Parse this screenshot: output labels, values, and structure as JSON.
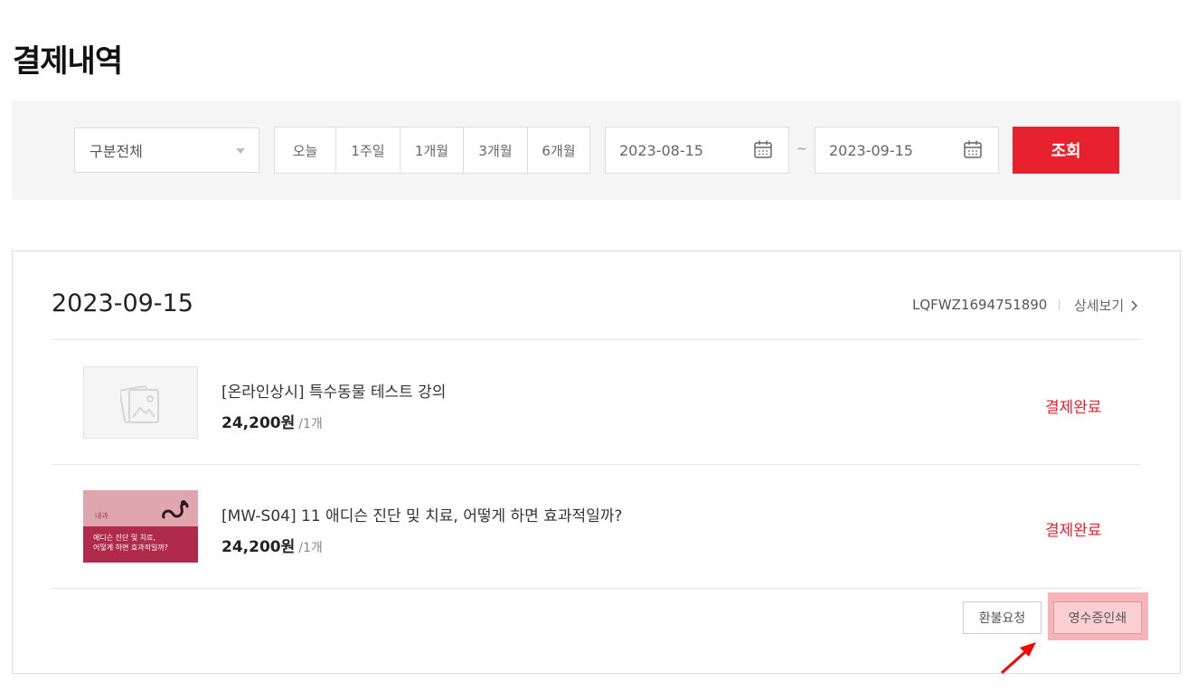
{
  "page": {
    "title": "결제내역"
  },
  "filter": {
    "category_selected": "구분전체",
    "periods": [
      "오늘",
      "1주일",
      "1개월",
      "3개월",
      "6개월"
    ],
    "date_from": "2023-08-15",
    "date_to": "2023-09-15",
    "range_separator": "~",
    "search_label": "조회"
  },
  "order": {
    "date": "2023-09-15",
    "order_no": "LQFWZ1694751890",
    "detail_label": "상세보기",
    "items": [
      {
        "title": "[온라인상시] 특수동물 테스트 강의",
        "price": "24,200원",
        "qty": "/1개",
        "status": "결제완료",
        "thumbnail": "placeholder-image-icon"
      },
      {
        "title": "[MW-S04] 11 애디슨 진단 및 치료, 어떻게 하면 효과적일까?",
        "price": "24,200원",
        "qty": "/1개",
        "status": "결제완료",
        "thumbnail_category": "내과",
        "thumbnail_caption": "애디슨 진단 및 치료,\n어떻게 하면 효과적일까?"
      }
    ],
    "refund_label": "환불요청",
    "receipt_label": "영수증인쇄"
  },
  "colors": {
    "accent": "#e8212f",
    "highlight": "#f7b3b8"
  }
}
